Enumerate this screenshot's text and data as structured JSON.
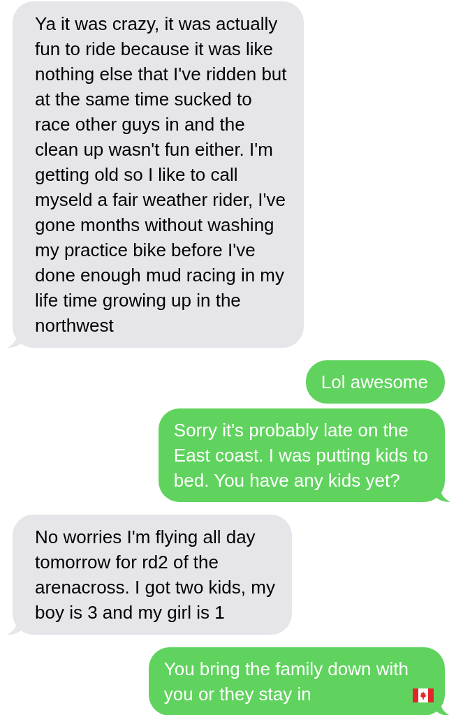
{
  "messages": [
    {
      "kind": "incoming",
      "tail": true,
      "text": "Ya it was crazy, it was actually\nfun to ride because it was like\nnothing else that I've ridden but\nat the same time sucked to\nrace other guys in and the\nclean up wasn't fun either. I'm\ngetting old so I like to call\nmyseld a fair weather rider, I've\ngone months without washing\nmy practice bike before I've\ndone enough mud racing in my\nlife time growing up in the\nnorthwest"
    },
    {
      "kind": "outgoing",
      "tail": false,
      "text": "Lol awesome"
    },
    {
      "kind": "outgoing",
      "tail": true,
      "text": "Sorry it's probably late on the\nEast coast. I was putting kids to\nbed. You have any kids yet?"
    },
    {
      "kind": "incoming",
      "tail": true,
      "text": "No worries I'm flying all day\ntomorrow for rd2 of the\narenacross. I got two kids, my\nboy is 3 and my girl is 1"
    },
    {
      "kind": "outgoing",
      "tail": true,
      "text": "You bring the family down with\nyou or they stay in",
      "attachments": [
        {
          "kind": "flag"
        }
      ]
    }
  ]
}
